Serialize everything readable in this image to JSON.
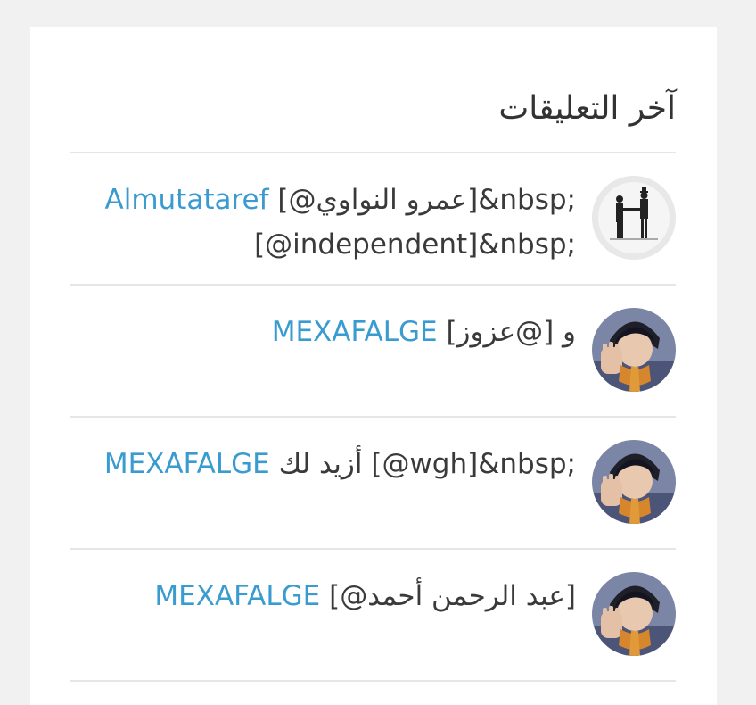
{
  "widget": {
    "title": "آخر التعليقات"
  },
  "comments": [
    {
      "author": "Almutataref",
      "avatar_icon": "silhouette-handshake-avatar",
      "text": "[@عمرو النواوي]&nbsp;[@independent]&nbsp;"
    },
    {
      "author": "MEXAFALGE",
      "avatar_icon": "anime-character-avatar",
      "text": "و [@عزوز]"
    },
    {
      "author": "MEXAFALGE",
      "avatar_icon": "anime-character-avatar",
      "text": "أزيد لك [@wgh]&nbsp;"
    },
    {
      "author": "MEXAFALGE",
      "avatar_icon": "anime-character-avatar",
      "text": "[@عبد الرحمن أحمد]"
    }
  ],
  "colors": {
    "link": "#3a9bd0",
    "text": "#3a3a3a",
    "divider": "#e6e6e6",
    "background": "#f1f1f1"
  }
}
